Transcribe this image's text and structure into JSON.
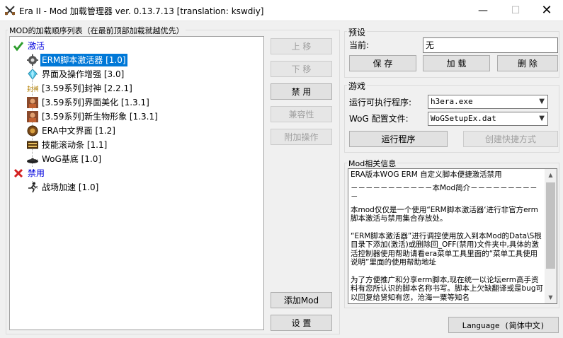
{
  "window": {
    "title": "Era II - Mod 加载管理器 ver. 0.13.7.13 [translation: kswdiy]",
    "minimize_glyph": "—",
    "maximize_glyph": "☐",
    "close_glyph": "✕"
  },
  "mod_list": {
    "group_title": "MOD的加载顺序列表（在最前顶部加载就越优先）",
    "enabled_category": {
      "label": "激活",
      "icon": "green-check-icon",
      "color": "#2e9e2e",
      "items": [
        {
          "label": "ERM脚本激活器 [1.0]",
          "icon": "gear-script-icon",
          "selected": true
        },
        {
          "label": "界面及操作增强 [3.0]",
          "icon": "crystal-icon",
          "selected": false
        },
        {
          "label": "[3.59系列]封神 [2.2.1]",
          "icon": "fengshen-logo-icon",
          "selected": false
        },
        {
          "label": "[3.59系列]界面美化 [1.3.1]",
          "icon": "portrait-icon",
          "selected": false
        },
        {
          "label": "[3.59系列]新生物形象 [1.3.1]",
          "icon": "portrait-icon",
          "selected": false
        },
        {
          "label": "ERA中文界面 [1.2]",
          "icon": "shield-emblem-icon",
          "selected": false
        },
        {
          "label": "技能滚动条 [1.1]",
          "icon": "scroll-bar-icon",
          "selected": false
        },
        {
          "label": "WoG基底 [1.0]",
          "icon": "hat-icon",
          "selected": false
        }
      ]
    },
    "disabled_category": {
      "label": "禁用",
      "icon": "red-x-icon",
      "color": "#d42020",
      "items": [
        {
          "label": "战场加速 [1.0]",
          "icon": "running-man-icon",
          "selected": false
        }
      ]
    }
  },
  "mod_buttons": {
    "move_up": "上 移",
    "move_down": "下 移",
    "disable": "禁 用",
    "compatibility": "兼容性",
    "extra_ops": "附加操作",
    "add_mod": "添加Mod",
    "settings": "设 置"
  },
  "preset": {
    "group_title": "预设",
    "current_label": "当前:",
    "current_value": "无",
    "save": "保 存",
    "load": "加 载",
    "delete": "删 除"
  },
  "game": {
    "group_title": "游戏",
    "exe_label": "运行可执行程序:",
    "exe_value": "h3era.exe",
    "wog_label": "WoG 配置文件:",
    "wog_value": "WoGSetupEx.dat",
    "run": "运行程序",
    "shortcut": "创建快捷方式"
  },
  "mod_info": {
    "group_title": "Mod相关信息",
    "paragraphs": [
      "ERA版本WOG ERM 自定义脚本便捷激活禁用",
      "－－－－－－－－－－－本Mod简介－－－－－－－－－－",
      "本mod仅仅是一个使用“ERM脚本激活器‘进行非官方erm脚本激活与禁用集合存放处。",
      "“ERM脚本激活器”进行调控使用放入到本Mod的Data\\S根目录下添加(激活)或删除回_OFF(禁用)文件夹中,具体的激活控制器使用帮助请看era菜单工具里面的“菜单工具使用说明”里面的使用帮助地址",
      "为了方便推广和分享erm脚本,现在统一以论坛erm高手资料有您所认识的脚本名称书写。脚本上欠缺翻译或是bug可以回复给贤知有您，沧海一粟等知名"
    ]
  },
  "language_button": "Language (简体中文)",
  "colors": {
    "selection": "#0078d7",
    "category_text": "#0000dd",
    "disabled_text": "#a0a0a0"
  }
}
